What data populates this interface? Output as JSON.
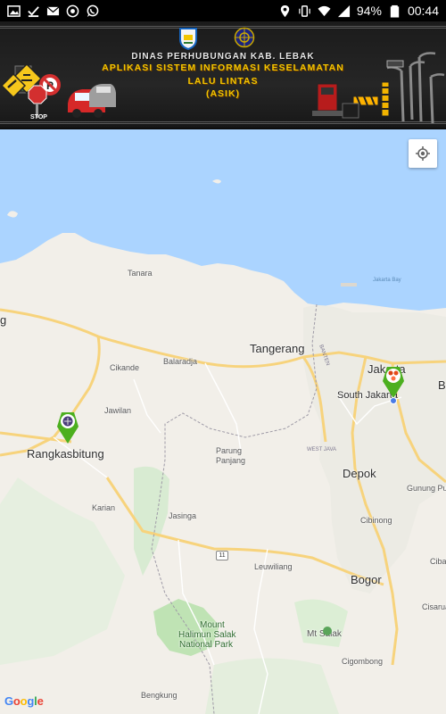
{
  "status_bar": {
    "battery": "94%",
    "time": "00:44",
    "icons": [
      "image-notification-icon",
      "check-notification-icon",
      "mail-notification-icon",
      "chrome-notification-icon",
      "whatsapp-notification-icon",
      "location-icon",
      "vibrate-icon",
      "wifi-icon",
      "signal-icon",
      "battery-icon"
    ]
  },
  "banner": {
    "line1": "DINAS PERHUBUNGAN KAB. LEBAK",
    "line2": "APLIKASI SISTEM INFORMASI KESELAMATAN",
    "line3": "LALU LINTAS",
    "line4": "(ASIK)",
    "sign_text": "STOP",
    "accent": "#f2c500"
  },
  "map": {
    "colors": {
      "sea": "#abd4ff",
      "land": "#f2efe9",
      "green": "#cde8c7",
      "road": "#f7d37c"
    },
    "places": {
      "tanara": "Tanara",
      "tangerang": "Tangerang",
      "cikande": "Cikande",
      "balaradja": "Balaradja",
      "jawilan": "Jawilan",
      "rangkasbitung": "Rangkasbitung",
      "parung_panjang_1": "Parung",
      "parung_panjang_2": "Panjang",
      "karian": "Karian",
      "jasinga": "Jasinga",
      "leuwiliang": "Leuwiliang",
      "bogor": "Bogor",
      "depok": "Depok",
      "cibinong": "Cibinong",
      "gunung_putri": "Gunung Pu",
      "jakarta": "Jakarta",
      "south_jakarta": "South Jakarta",
      "b_edge": "B",
      "cibarusah": "Ciba",
      "cisarua": "Cisarua",
      "mt_salak": "Mt Salak",
      "halimun_1": "Mount",
      "halimun_2": "Halimun Salak",
      "halimun_3": "National Park",
      "cigombong": "Cigombong",
      "bengkung": "Bengkung",
      "jakarta_bay": "Jakarta Bay",
      "west_java": "WEST JAVA",
      "banten": "BANTEN",
      "left_edge": "g"
    },
    "road_shield": "11",
    "google": [
      {
        "ch": "G",
        "color": "#4285f4"
      },
      {
        "ch": "o",
        "color": "#ea4335"
      },
      {
        "ch": "o",
        "color": "#fbbc05"
      },
      {
        "ch": "g",
        "color": "#4285f4"
      },
      {
        "ch": "l",
        "color": "#34a853"
      },
      {
        "ch": "e",
        "color": "#ea4335"
      }
    ],
    "markers": [
      {
        "name": "rangkasbitung-marker-icon",
        "color": "#4caf1f"
      },
      {
        "name": "jakarta-marker-icon",
        "color": "#4caf1f"
      }
    ]
  }
}
